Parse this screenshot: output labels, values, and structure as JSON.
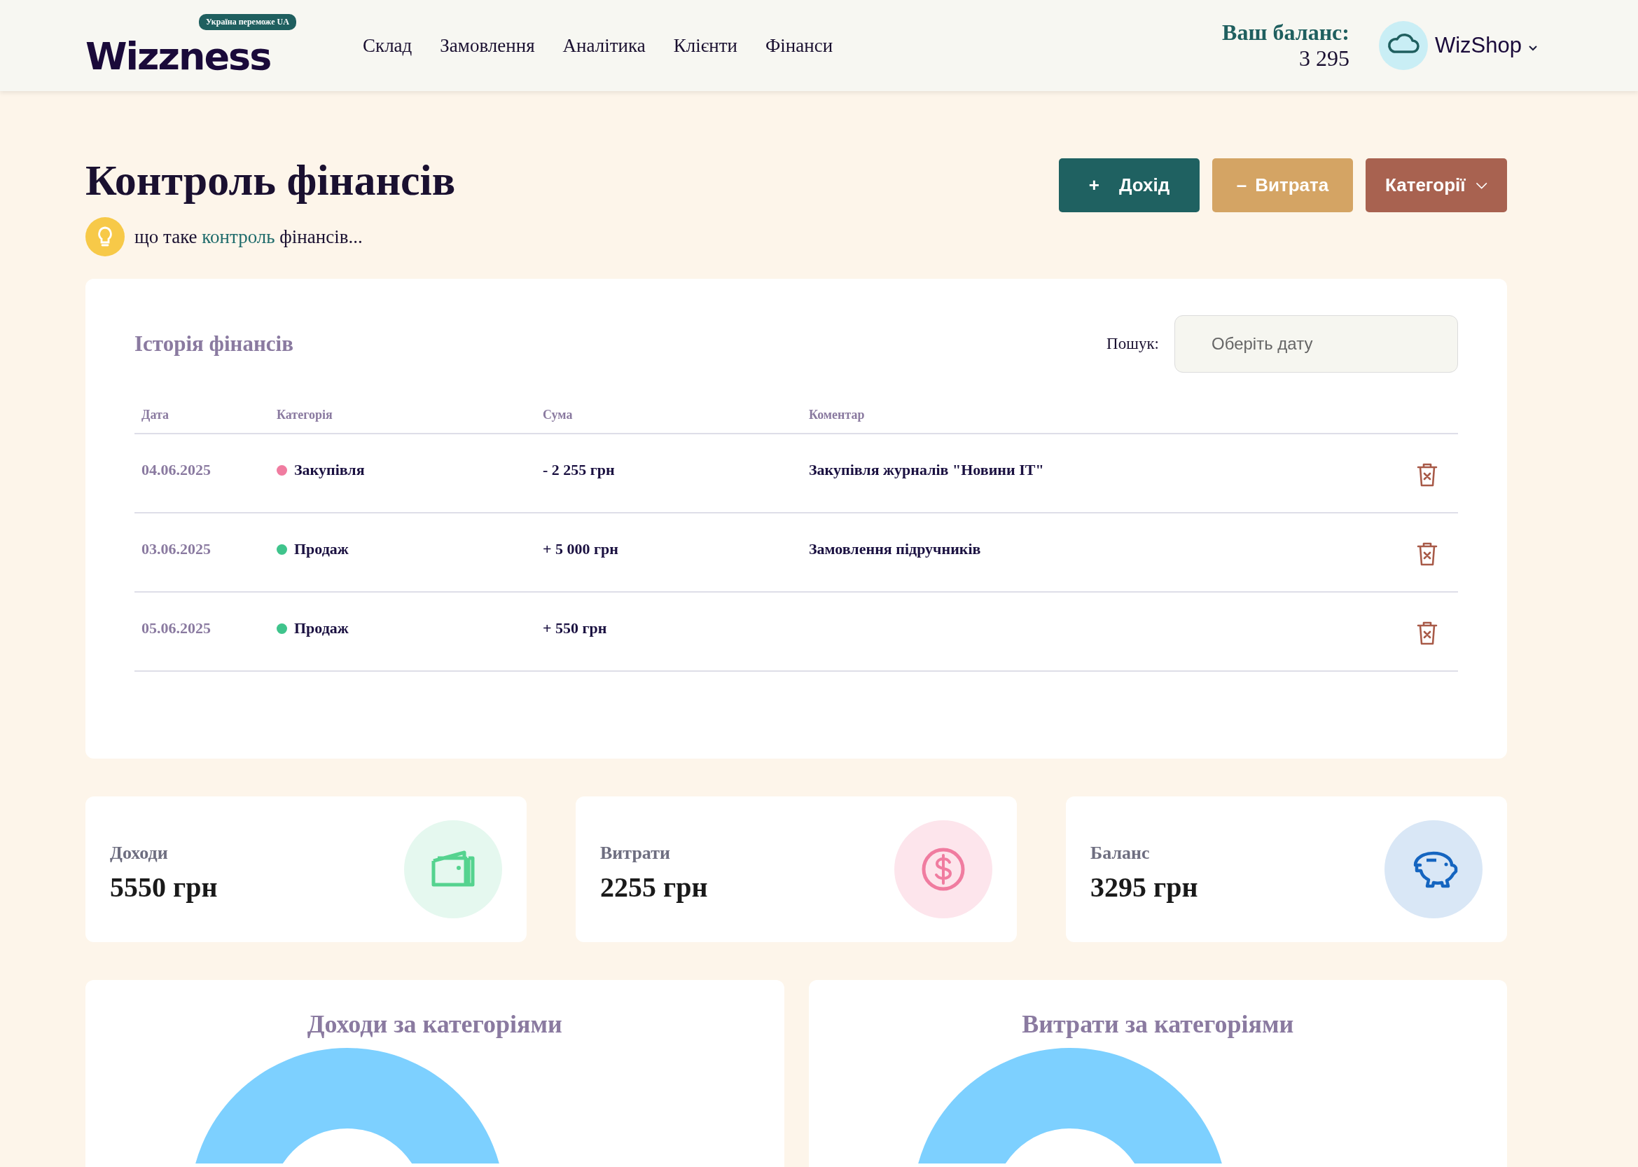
{
  "header": {
    "logo": "Wizzness",
    "logo_badge": "Україна переможе UA",
    "nav": [
      "Склад",
      "Замовлення",
      "Аналітика",
      "Клієнти",
      "Фінанси"
    ],
    "balance_label": "Ваш баланс:",
    "balance_value": "3 295",
    "user": "WizShop"
  },
  "page": {
    "title": "Контроль фінансів",
    "hint_before": "що таке",
    "hint_link": "контроль",
    "hint_after": "фінансів..."
  },
  "actions": [
    {
      "kind": "income",
      "sign": "+",
      "label": "Дохід"
    },
    {
      "kind": "expense",
      "sign": "–",
      "label": "Витрата"
    },
    {
      "kind": "categories",
      "label": "Категорії"
    }
  ],
  "history": {
    "title": "Історія фінансів",
    "search_label": "Пошук:",
    "search_placeholder": "Оберіть дату",
    "columns": [
      "Дата",
      "Категорія",
      "Сума",
      "Коментар"
    ],
    "rows": [
      {
        "date": "04.06.2025",
        "category": "Закупівля",
        "color": "#f07ca0",
        "amount": "- 2 255 грн",
        "comment": "Закупівля журналів \"Новини IT\""
      },
      {
        "date": "03.06.2025",
        "category": "Продаж",
        "color": "#3fc48c",
        "amount": "+ 5 000 грн",
        "comment": "Замовлення підручників"
      },
      {
        "date": "05.06.2025",
        "category": "Продаж",
        "color": "#3fc48c",
        "amount": "+ 550 грн"
      }
    ]
  },
  "stats": [
    {
      "kind": "income",
      "label": "Доходи",
      "value": "5550 грн"
    },
    {
      "kind": "expense",
      "label": "Витрати",
      "value": "2255 грн"
    },
    {
      "kind": "balance",
      "label": "Баланс",
      "value": "3295 грн"
    }
  ],
  "charts": [
    {
      "title": "Доходи за категоріями"
    },
    {
      "title": "Витрати за категоріями"
    }
  ]
}
